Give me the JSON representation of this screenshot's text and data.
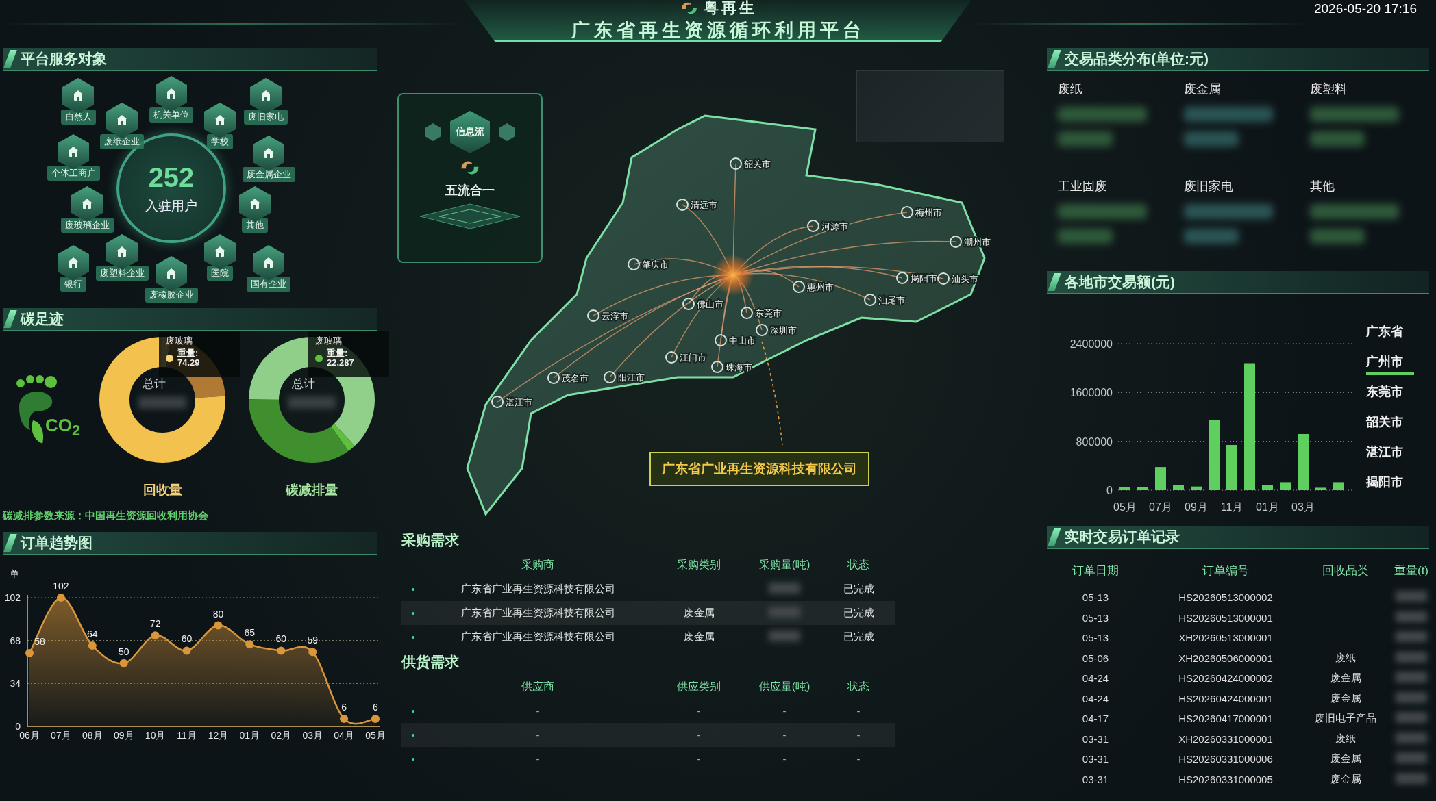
{
  "header": {
    "logo_text": "粤再生",
    "title": "广东省再生资源循环利用平台",
    "datetime": "2026-05-20 17:16"
  },
  "service_targets": {
    "title": "平台服务对象",
    "count": "252",
    "count_label": "入驻用户",
    "items": [
      {
        "label": "自然人"
      },
      {
        "label": "机关单位"
      },
      {
        "label": "废旧家电"
      },
      {
        "label": "废纸企业"
      },
      {
        "label": "学校"
      },
      {
        "label": "个体工商户"
      },
      {
        "label": "废金属企业"
      },
      {
        "label": "废玻璃企业"
      },
      {
        "label": "其他"
      },
      {
        "label": "银行"
      },
      {
        "label": "废塑料企业"
      },
      {
        "label": "废橡胶企业"
      },
      {
        "label": "医院"
      },
      {
        "label": "国有企业"
      }
    ]
  },
  "carbon": {
    "title": "碳足迹",
    "icon_text": "CO$_{2}$",
    "donuts": [
      {
        "total_label": "总计",
        "caption": "回收量",
        "tooltip": {
          "name": "废玻璃",
          "field": "重量:",
          "value": "74.29",
          "color": "#f7d57a"
        }
      },
      {
        "total_label": "总计",
        "caption": "碳减排量",
        "tooltip": {
          "name": "废玻璃",
          "field": "重量:",
          "value": "22.287",
          "color": "#5fbf3f"
        }
      }
    ],
    "source": "碳减排参数来源：中国再生资源回收利用协会"
  },
  "order_trend": {
    "title": "订单趋势图",
    "chart_data": {
      "type": "area",
      "ylabel": "单",
      "categories": [
        "06月",
        "07月",
        "08月",
        "09月",
        "10月",
        "11月",
        "12月",
        "01月",
        "02月",
        "03月",
        "04月",
        "05月"
      ],
      "series": [
        {
          "color": "#d9963a",
          "values": [
            58,
            102,
            64,
            50,
            72,
            60,
            80,
            65,
            60,
            59,
            6,
            6
          ]
        }
      ],
      "ylim": [
        0,
        102
      ],
      "yticks": [
        0,
        34,
        68,
        102
      ],
      "data_labels": true
    }
  },
  "map": {
    "flow_panel": {
      "badge": "信息流",
      "title": "五流合一"
    },
    "cities": [
      {
        "name": "韶关市"
      },
      {
        "name": "清远市"
      },
      {
        "name": "肇庆市"
      },
      {
        "name": "河源市"
      },
      {
        "name": "梅州市"
      },
      {
        "name": "潮州市"
      },
      {
        "name": "揭阳市"
      },
      {
        "name": "汕头市"
      },
      {
        "name": "佛山市"
      },
      {
        "name": "东莞市"
      },
      {
        "name": "惠州市"
      },
      {
        "name": "汕尾市"
      },
      {
        "name": "云浮市"
      },
      {
        "name": "江门市"
      },
      {
        "name": "中山市"
      },
      {
        "name": "深圳市"
      },
      {
        "name": "珠海市"
      },
      {
        "name": "阳江市"
      },
      {
        "name": "茂名市"
      },
      {
        "name": "湛江市"
      }
    ],
    "callout": "广东省广业再生资源科技有限公司"
  },
  "purchase": {
    "title": "采购需求",
    "columns": [
      "采购商",
      "采购类别",
      "采购量(吨)",
      "状态"
    ],
    "rows": [
      {
        "party": "广东省广业再生资源科技有限公司",
        "status": "已完成"
      },
      {
        "party": "广东省广业再生资源科技有限公司",
        "category": "废金属",
        "status": "已完成"
      },
      {
        "party": "广东省广业再生资源科技有限公司",
        "category": "废金属",
        "status": "已完成"
      }
    ]
  },
  "supply": {
    "title": "供货需求",
    "columns": [
      "供应商",
      "供应类别",
      "供应量(吨)",
      "状态"
    ],
    "rows": [
      [
        "-",
        "-",
        "-",
        "-"
      ],
      [
        "-",
        "-",
        "-",
        "-"
      ],
      [
        "-",
        "-",
        "-",
        "-"
      ]
    ]
  },
  "category_distribution": {
    "title": "交易品类分布(单位:元)",
    "items": [
      {
        "label": "废纸"
      },
      {
        "label": "废金属"
      },
      {
        "label": "废塑料"
      },
      {
        "label": "工业固废"
      },
      {
        "label": "废旧家电"
      },
      {
        "label": "其他"
      }
    ]
  },
  "city_trade": {
    "title": "各地市交易额(元)",
    "chart_data": {
      "type": "bar",
      "categories": [
        "05月",
        null,
        "07月",
        null,
        "09月",
        null,
        "11月",
        null,
        "01月",
        null,
        "03月",
        null,
        null
      ],
      "series": [
        {
          "color": "#5fd05f",
          "values": [
            50000,
            50000,
            380000,
            80000,
            60000,
            1150000,
            740000,
            2080000,
            80000,
            130000,
            920000,
            40000,
            130000
          ]
        }
      ],
      "ylim": [
        0,
        2400000
      ],
      "yticks": [
        0,
        800000,
        1600000,
        2400000
      ]
    },
    "regions": [
      {
        "label": "广东省",
        "selected": false
      },
      {
        "label": "广州市",
        "selected": true
      },
      {
        "label": "东莞市",
        "selected": false
      },
      {
        "label": "韶关市",
        "selected": false
      },
      {
        "label": "湛江市",
        "selected": false
      },
      {
        "label": "揭阳市",
        "selected": false
      }
    ]
  },
  "orders": {
    "title": "实时交易订单记录",
    "columns": [
      "订单日期",
      "订单编号",
      "回收品类",
      "重量(t)"
    ],
    "rows": [
      {
        "date": "05-13",
        "number": "HS20260513000002"
      },
      {
        "date": "05-13",
        "number": "HS20260513000001"
      },
      {
        "date": "05-13",
        "number": "XH20260513000001"
      },
      {
        "date": "05-06",
        "number": "XH20260506000001",
        "category": "废纸"
      },
      {
        "date": "04-24",
        "number": "HS20260424000002",
        "category": "废金属"
      },
      {
        "date": "04-24",
        "number": "HS20260424000001",
        "category": "废金属"
      },
      {
        "date": "04-17",
        "number": "HS20260417000001",
        "category": "废旧电子产品"
      },
      {
        "date": "03-31",
        "number": "XH20260331000001",
        "category": "废纸"
      },
      {
        "date": "03-31",
        "number": "HS20260331000006",
        "category": "废金属"
      },
      {
        "date": "03-31",
        "number": "HS20260331000005",
        "category": "废金属"
      }
    ]
  }
}
